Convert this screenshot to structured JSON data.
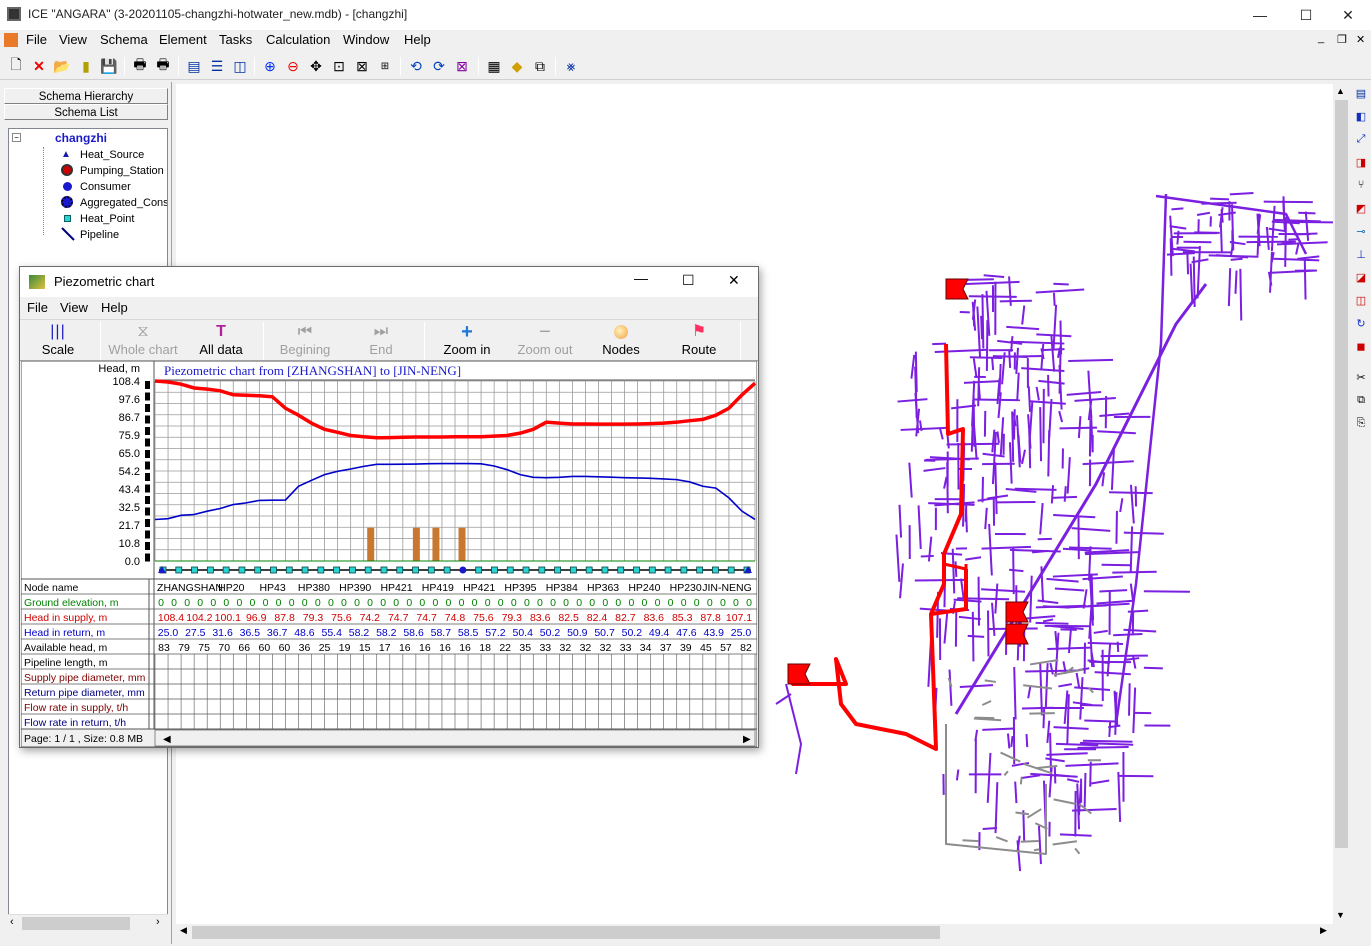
{
  "window": {
    "title": "ICE \"ANGARA\" (3-20201105-changzhi-hotwater_new.mdb) - [changzhi]",
    "controls": {
      "minimize": "—",
      "maximize": "☐",
      "close": "✕"
    },
    "mdi_controls": {
      "minimize": "_",
      "restore": "❐",
      "close": "✕"
    }
  },
  "menu": [
    "File",
    "View",
    "Schema",
    "Element",
    "Tasks",
    "Calculation",
    "Window",
    "Help"
  ],
  "left_panel": {
    "tabs": [
      "Schema Hierarchy",
      "Schema List"
    ],
    "tree_root": "changzhi",
    "tree_items": [
      "Heat_Source",
      "Pumping_Station",
      "Consumer",
      "Aggregated_Cons",
      "Heat_Point",
      "Pipeline"
    ]
  },
  "piezo": {
    "title": "Piezometric chart",
    "menu": [
      "File",
      "View",
      "Help"
    ],
    "toolbar": [
      {
        "label": "Scale",
        "enabled": true,
        "icon": "scale-icon"
      },
      {
        "label": "Whole chart",
        "enabled": false,
        "icon": "whole-chart-icon"
      },
      {
        "label": "All data",
        "enabled": true,
        "icon": "all-data-icon"
      },
      {
        "label": "Begining",
        "enabled": false,
        "icon": "begin-icon"
      },
      {
        "label": "End",
        "enabled": false,
        "icon": "end-icon"
      },
      {
        "label": "Zoom in",
        "enabled": true,
        "icon": "zoom-in-icon"
      },
      {
        "label": "Zoom out",
        "enabled": false,
        "icon": "zoom-out-icon"
      },
      {
        "label": "Nodes",
        "enabled": true,
        "icon": "nodes-icon"
      },
      {
        "label": "Route",
        "enabled": true,
        "icon": "route-icon"
      }
    ],
    "status": "Page: 1 / 1 , Size: 0.8 MB",
    "table": {
      "row_labels": [
        "Node name",
        "Ground elevation, m",
        "Head in supply, m",
        "Head in return, m",
        "Available head, m",
        "Pipeline length, m",
        "Supply pipe diameter, mm",
        "Return pipe diameter, mm",
        "Flow rate in supply, t/h",
        "Flow rate in return, t/h"
      ],
      "node_names": [
        "ZHANGSHAN",
        "HP20",
        "HP43",
        "HP380",
        "HP390",
        "HP421",
        "HP419",
        "HP421",
        "HP395",
        "HP384",
        "HP363",
        "HP240",
        "HP230",
        "JIN-NENG"
      ],
      "ground": [
        "0",
        "0",
        "0",
        "0",
        "0",
        "0",
        "0",
        "0",
        "0",
        "0",
        "0",
        "0",
        "0",
        "0",
        "0",
        "0",
        "0",
        "0",
        "0",
        "0",
        "0",
        "0",
        "0",
        "0",
        "0",
        "0",
        "0",
        "0",
        "0",
        "0",
        "0",
        "0",
        "0",
        "0",
        "0",
        "0",
        "0",
        "0",
        "0",
        "0",
        "0",
        "0",
        "0",
        "0",
        "0",
        "0"
      ],
      "supply": [
        "108.4",
        "104.2",
        "100.1",
        "96.9",
        "87.8",
        "79.3",
        "75.6",
        "74.2",
        "74.7",
        "74.7",
        "74.8",
        "75.6",
        "79.3",
        "83.6",
        "82.5",
        "82.4",
        "82.7",
        "83.6",
        "85.3",
        "87.8",
        "107.1"
      ],
      "return": [
        "25.0",
        "27.5",
        "31.6",
        "36.5",
        "36.7",
        "48.6",
        "55.4",
        "58.2",
        "58.2",
        "58.6",
        "58.7",
        "58.5",
        "57.2",
        "50.4",
        "50.2",
        "50.9",
        "50.7",
        "50.2",
        "49.4",
        "47.6",
        "43.9",
        "25.0"
      ],
      "available": [
        "83",
        "79",
        "75",
        "70",
        "66",
        "60",
        "60",
        "36",
        "25",
        "19",
        "15",
        "17",
        "16",
        "16",
        "16",
        "16",
        "18",
        "22",
        "35",
        "33",
        "32",
        "32",
        "32",
        "33",
        "34",
        "37",
        "39",
        "45",
        "57",
        "82"
      ]
    }
  },
  "chart_data": {
    "type": "line",
    "title": "Piezometric chart from [ZHANGSHAN] to [JIN-NENG]",
    "ylabel": "Head, m",
    "y_ticks": [
      "108.4",
      "97.6",
      "86.7",
      "75.9",
      "65.0",
      "54.2",
      "43.4",
      "32.5",
      "21.7",
      "10.8",
      "0.0"
    ],
    "ylim": [
      0,
      108.4
    ],
    "series": [
      {
        "name": "Head in supply, m",
        "color": "#ff0000",
        "x": [
          0,
          1,
          2,
          3,
          4,
          5,
          6,
          7,
          8,
          9,
          10,
          11,
          12,
          13,
          14,
          15,
          16,
          17,
          18,
          19,
          20,
          21,
          22,
          23,
          24,
          25,
          26,
          27,
          28,
          29,
          30,
          31,
          32,
          33,
          34,
          35,
          36,
          37,
          38,
          39,
          40,
          41,
          42,
          43,
          44,
          45,
          46
        ],
        "values": [
          108.4,
          107.8,
          106.5,
          104.2,
          103.5,
          102.5,
          100.1,
          99.8,
          99.5,
          98.9,
          92,
          87.8,
          83,
          79.3,
          77.5,
          75.6,
          74.8,
          74.2,
          74.3,
          74.5,
          74.7,
          74.7,
          74.7,
          74.8,
          74.8,
          74.8,
          75.2,
          75.6,
          77,
          79.3,
          83.6,
          83,
          82.5,
          82.5,
          82.4,
          82.4,
          82.4,
          82.5,
          82.7,
          83,
          83.6,
          84.5,
          85.3,
          87.8,
          92,
          100,
          107.1
        ]
      },
      {
        "name": "Head in return, m",
        "color": "#0000c8",
        "x": [
          0,
          1,
          2,
          3,
          4,
          5,
          6,
          7,
          8,
          9,
          10,
          11,
          12,
          13,
          14,
          15,
          16,
          17,
          18,
          19,
          20,
          21,
          22,
          23,
          24,
          25,
          26,
          27,
          28,
          29,
          30,
          31,
          32,
          33,
          34,
          35,
          36,
          37,
          38,
          39,
          40,
          41,
          42,
          43,
          44,
          45,
          46
        ],
        "values": [
          25,
          25.5,
          27.5,
          28,
          30,
          31.6,
          34,
          35,
          36.5,
          36.6,
          36.7,
          45,
          48.6,
          52,
          54,
          55.4,
          57,
          58.2,
          58.2,
          58.3,
          58.4,
          58.6,
          58.7,
          58.7,
          58.7,
          58.5,
          57.2,
          55,
          52,
          50.4,
          50.2,
          50.4,
          50.9,
          50.9,
          50.7,
          50.5,
          50.2,
          50,
          49.8,
          49.4,
          49,
          47.6,
          45,
          43.9,
          38,
          30,
          25
        ]
      },
      {
        "name": "Ground elevation, m",
        "color": "#008000",
        "x": [
          0,
          46
        ],
        "values": [
          0,
          0
        ]
      }
    ],
    "markers": [
      {
        "x": 16.5,
        "height": 20
      },
      {
        "x": 20,
        "height": 20
      },
      {
        "x": 21.5,
        "height": 20
      },
      {
        "x": 23.5,
        "height": 20
      }
    ],
    "xlim": [
      0,
      46
    ],
    "grid": true
  }
}
